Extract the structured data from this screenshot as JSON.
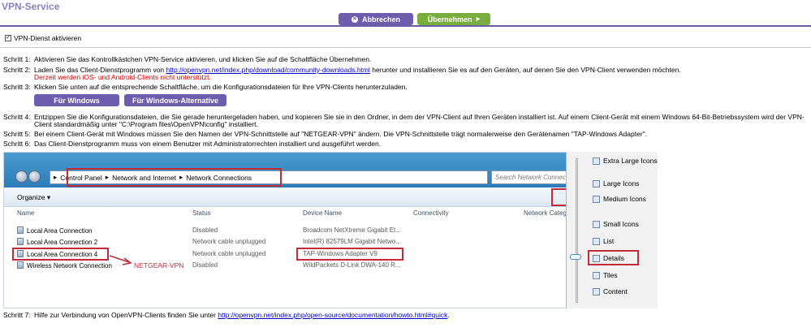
{
  "header": {
    "title": "VPN-Service",
    "cancel_label": "Abbrechen",
    "apply_label": "Übernehmen"
  },
  "checkbox": {
    "label": "VPN-Dienst aktivieren",
    "checked": true
  },
  "steps": {
    "s1": {
      "label": "Schritt 1:",
      "text": "Aktivieren Sie das Kontrollkästchen VPN-Service aktivieren, und klicken Sie auf die Schaltfläche Übernehmen."
    },
    "s2": {
      "label": "Schritt 2:",
      "pre": "Laden Sie das Client-Dienstprogramm von ",
      "link": "http://openvpn.net/index.php/download/community-downloads.html",
      "post": " herunter und installieren Sie es auf den Geräten, auf denen Sie den VPN-Client verwenden möchten.",
      "warning": "Derzeit werden iOS- und Android-Clients nicht unterstützt."
    },
    "s3": {
      "label": "Schritt 3:",
      "text": "Klicken Sie unten auf die entsprechende Schaltfläche, um die Konfigurationsdateien für Ihre VPN-Clients herunterzuladen."
    },
    "s4": {
      "label": "Schritt 4:",
      "text": "Entzippen Sie die Konfigurationsdateien, die Sie gerade heruntergeladen haben, und kopieren Sie sie in den Ordner, in dem der VPN-Client auf Ihren Geräten installiert ist. Auf einem Client-Gerät mit einem Windows 64-Bit-Betriebssystem wird der VPN-",
      "text2": "Client standardmäßig unter \"C:\\Program files\\OpenVPN\\config\" installiert."
    },
    "s5": {
      "label": "Schritt 5:",
      "text": "Bei einem Client-Gerät mit Windows müssen Sie den Namen der VPN-Schnittstelle auf \"NETGEAR-VPN\" ändern. Die VPN-Schnittstelle trägt normalerweise den Gerätenamen \"TAP-Windows Adapter\"."
    },
    "s6": {
      "label": "Schritt 6:",
      "text": "Das Client-Dienstprogramm muss von einem Benutzer mit Administratorrechten installiert und ausgeführt werden."
    },
    "s7": {
      "label": "Schritt 7:",
      "pre": "Hilfe zur Verbindung von OpenVPN-Clients finden Sie unter ",
      "link": "http://openvpn.net/index.php/open-source/documentation/howto.html#quick",
      "post": "."
    }
  },
  "download_buttons": {
    "windows": "Für Windows",
    "windows_alt": "Für Windows-Alternative"
  },
  "screenshot": {
    "breadcrumb": [
      "Control Panel",
      "Network and Internet",
      "Network Connections"
    ],
    "search_placeholder": "Search Network Connections",
    "organize": "Organize",
    "columns": [
      "Name",
      "Status",
      "Device Name",
      "Connectivity",
      "Network Category"
    ],
    "rows": [
      {
        "name": "Local Area Connection",
        "status": "Disabled",
        "device": "Broadcom NetXtreme Gigabit Et..."
      },
      {
        "name": "Local Area Connection 2",
        "status": "Network cable unplugged",
        "device": "Intel(R) 82579LM Gigabit Netwo..."
      },
      {
        "name": "Local Area Connection 4",
        "status": "Network cable unplugged",
        "device": "TAP-Windows Adapter V9"
      },
      {
        "name": "Wireless Network Connection",
        "status": "Disabled",
        "device": "WildPackets D-Link DWA-140 R..."
      }
    ],
    "annotation": "NETGEAR-VPN",
    "view_menu": [
      "Extra Large Icons",
      "Large Icons",
      "Medium Icons",
      "Small Icons",
      "List",
      "Details",
      "Tiles",
      "Content"
    ],
    "selected_view": "Details"
  },
  "colors": {
    "purple": "#6d5ead",
    "green": "#79ad3e",
    "red_annotation": "#c22b3a"
  }
}
